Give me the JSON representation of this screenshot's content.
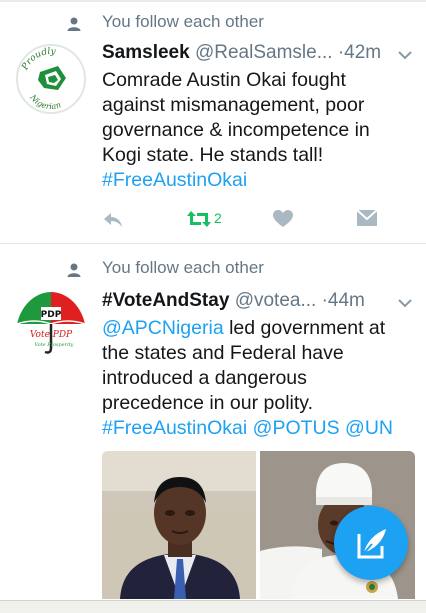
{
  "tweets": [
    {
      "social_context": "You follow each other",
      "name": "Samsleek",
      "handle": "@RealSamsle...",
      "separator": "·",
      "time": "42m",
      "avatar_text_top": "Proudly",
      "avatar_text_bottom": "Nigerian",
      "body_line1": "Comrade Austin Okai fought",
      "body_line2": "against mismanagement, poor",
      "body_line3": "governance & incompetence in",
      "body_line4": "Kogi state. He stands tall!",
      "hashtag": "#FreeAustinOkai",
      "retweet_count": "2"
    },
    {
      "social_context": "You follow each other",
      "name": "#VoteAndStay",
      "handle": "@votea...",
      "separator": "·",
      "time": "44m",
      "avatar_text_top": "PDP",
      "avatar_text_mid": "Vote PDP",
      "avatar_text_bottom": "Vote Prosperity",
      "mention1": "@APCNigeria",
      "body_line1_rest": " led government at",
      "body_line2": "the states and Federal have",
      "body_line3": "introduced a dangerous",
      "body_line4": "precedence in our polity.",
      "hashtag": "#FreeAustinOkai",
      "mention2": " @POTUS",
      "mention3": " @UN"
    }
  ],
  "colors": {
    "accent": "#1da1f2",
    "retweet_active": "#17bf63",
    "secondary_text": "#657786",
    "divider": "#e1e8ed"
  },
  "icons": {
    "social": "person-icon",
    "reply": "reply-icon",
    "retweet": "retweet-icon",
    "like": "heart-icon",
    "dm": "envelope-icon",
    "caret": "chevron-down-icon",
    "compose": "compose-tweet-icon"
  }
}
